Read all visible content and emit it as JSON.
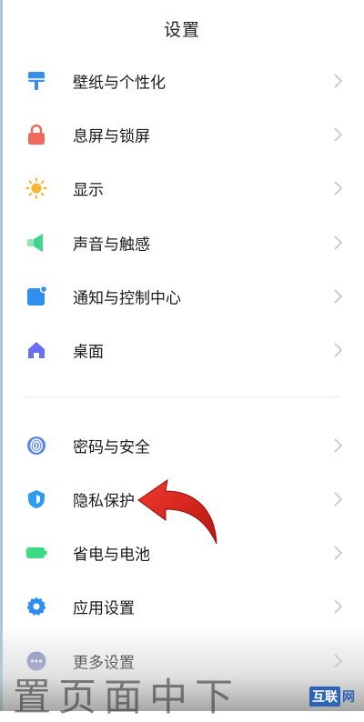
{
  "header": {
    "title": "设置"
  },
  "settings": [
    {
      "label": "壁纸与个性化",
      "icon": "paintbrush-icon"
    },
    {
      "label": "息屏与锁屏",
      "icon": "lock-icon"
    },
    {
      "label": "显示",
      "icon": "sun-icon"
    },
    {
      "label": "声音与触感",
      "icon": "speaker-icon"
    },
    {
      "label": "通知与控制中心",
      "icon": "notification-icon"
    },
    {
      "label": "桌面",
      "icon": "home-icon"
    },
    {
      "label": "密码与安全",
      "icon": "fingerprint-icon"
    },
    {
      "label": "隐私保护",
      "icon": "privacy-shield-icon"
    },
    {
      "label": "省电与电池",
      "icon": "battery-icon"
    },
    {
      "label": "应用设置",
      "icon": "gear-icon"
    },
    {
      "label": "更多设置",
      "icon": "more-dots-icon"
    }
  ],
  "overlay": {
    "caption": "置页面中下"
  },
  "watermark": {
    "box": "互联",
    "text": "网"
  },
  "colors": {
    "wallpaper": "#3a8ee6",
    "lock": "#ef6a5e",
    "display": "#f5b630",
    "sound": "#45d28c",
    "notification": "#2f8ef0",
    "home": "#6a6ff2",
    "password": "#5a86f0",
    "privacy": "#2d9bf0",
    "battery": "#3ddc84",
    "apps": "#2d8ef0",
    "more": "#8a93c8",
    "arrow": "#d8231d"
  }
}
